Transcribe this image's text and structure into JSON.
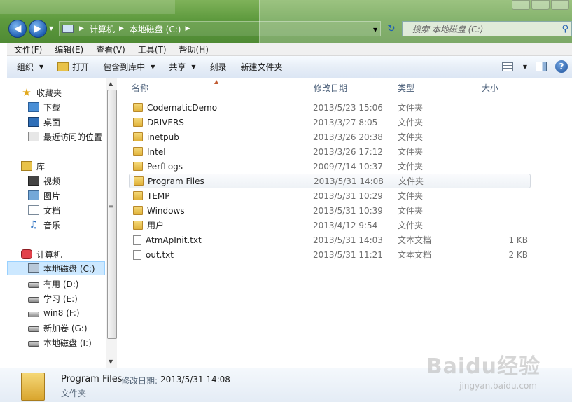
{
  "address": {
    "crumbs": [
      "计算机",
      "本地磁盘 (C:)"
    ],
    "search_placeholder": "搜索 本地磁盘 (C:)"
  },
  "menu": [
    "文件(F)",
    "编辑(E)",
    "查看(V)",
    "工具(T)",
    "帮助(H)"
  ],
  "toolbar": {
    "organize": "组织",
    "open": "打开",
    "include_in_library": "包含到库中",
    "share": "共享",
    "burn": "刻录",
    "new_folder": "新建文件夹"
  },
  "nav": {
    "favorites": "收藏夹",
    "downloads": "下载",
    "desktop": "桌面",
    "recent": "最近访问的位置",
    "libraries": "库",
    "videos": "视频",
    "pictures": "图片",
    "documents": "文档",
    "music": "音乐",
    "computer": "计算机",
    "drives": [
      "本地磁盘 (C:)",
      "有用 (D:)",
      "学习 (E:)",
      "win8 (F:)",
      "新加卷 (G:)",
      "本地磁盘 (I:)"
    ]
  },
  "columns": {
    "name": "名称",
    "date": "修改日期",
    "type": "类型",
    "size": "大小"
  },
  "files": [
    {
      "name": "CodematicDemo",
      "date": "2013/5/23 15:06",
      "type": "文件夹",
      "size": ""
    },
    {
      "name": "DRIVERS",
      "date": "2013/3/27 8:05",
      "type": "文件夹",
      "size": ""
    },
    {
      "name": "inetpub",
      "date": "2013/3/26 20:38",
      "type": "文件夹",
      "size": ""
    },
    {
      "name": "Intel",
      "date": "2013/3/26 17:12",
      "type": "文件夹",
      "size": ""
    },
    {
      "name": "PerfLogs",
      "date": "2009/7/14 10:37",
      "type": "文件夹",
      "size": ""
    },
    {
      "name": "Program Files",
      "date": "2013/5/31 14:08",
      "type": "文件夹",
      "size": ""
    },
    {
      "name": "TEMP",
      "date": "2013/5/31 10:29",
      "type": "文件夹",
      "size": ""
    },
    {
      "name": "Windows",
      "date": "2013/5/31 10:39",
      "type": "文件夹",
      "size": ""
    },
    {
      "name": "用户",
      "date": "2013/4/12 9:54",
      "type": "文件夹",
      "size": ""
    },
    {
      "name": "AtmApInit.txt",
      "date": "2013/5/31 14:03",
      "type": "文本文档",
      "size": "1 KB"
    },
    {
      "name": "out.txt",
      "date": "2013/5/31 11:21",
      "type": "文本文档",
      "size": "2 KB"
    }
  ],
  "details": {
    "name": "Program Files",
    "date_label": "修改日期:",
    "date": "2013/5/31 14:08",
    "type": "文件夹"
  },
  "watermark": {
    "text": "Baidu经验",
    "sub": "jingyan.baidu.com"
  },
  "icons": {
    "back": "back-arrow-icon",
    "forward": "forward-arrow-icon",
    "refresh": "refresh-icon",
    "search": "search-icon",
    "help": "help-icon"
  }
}
